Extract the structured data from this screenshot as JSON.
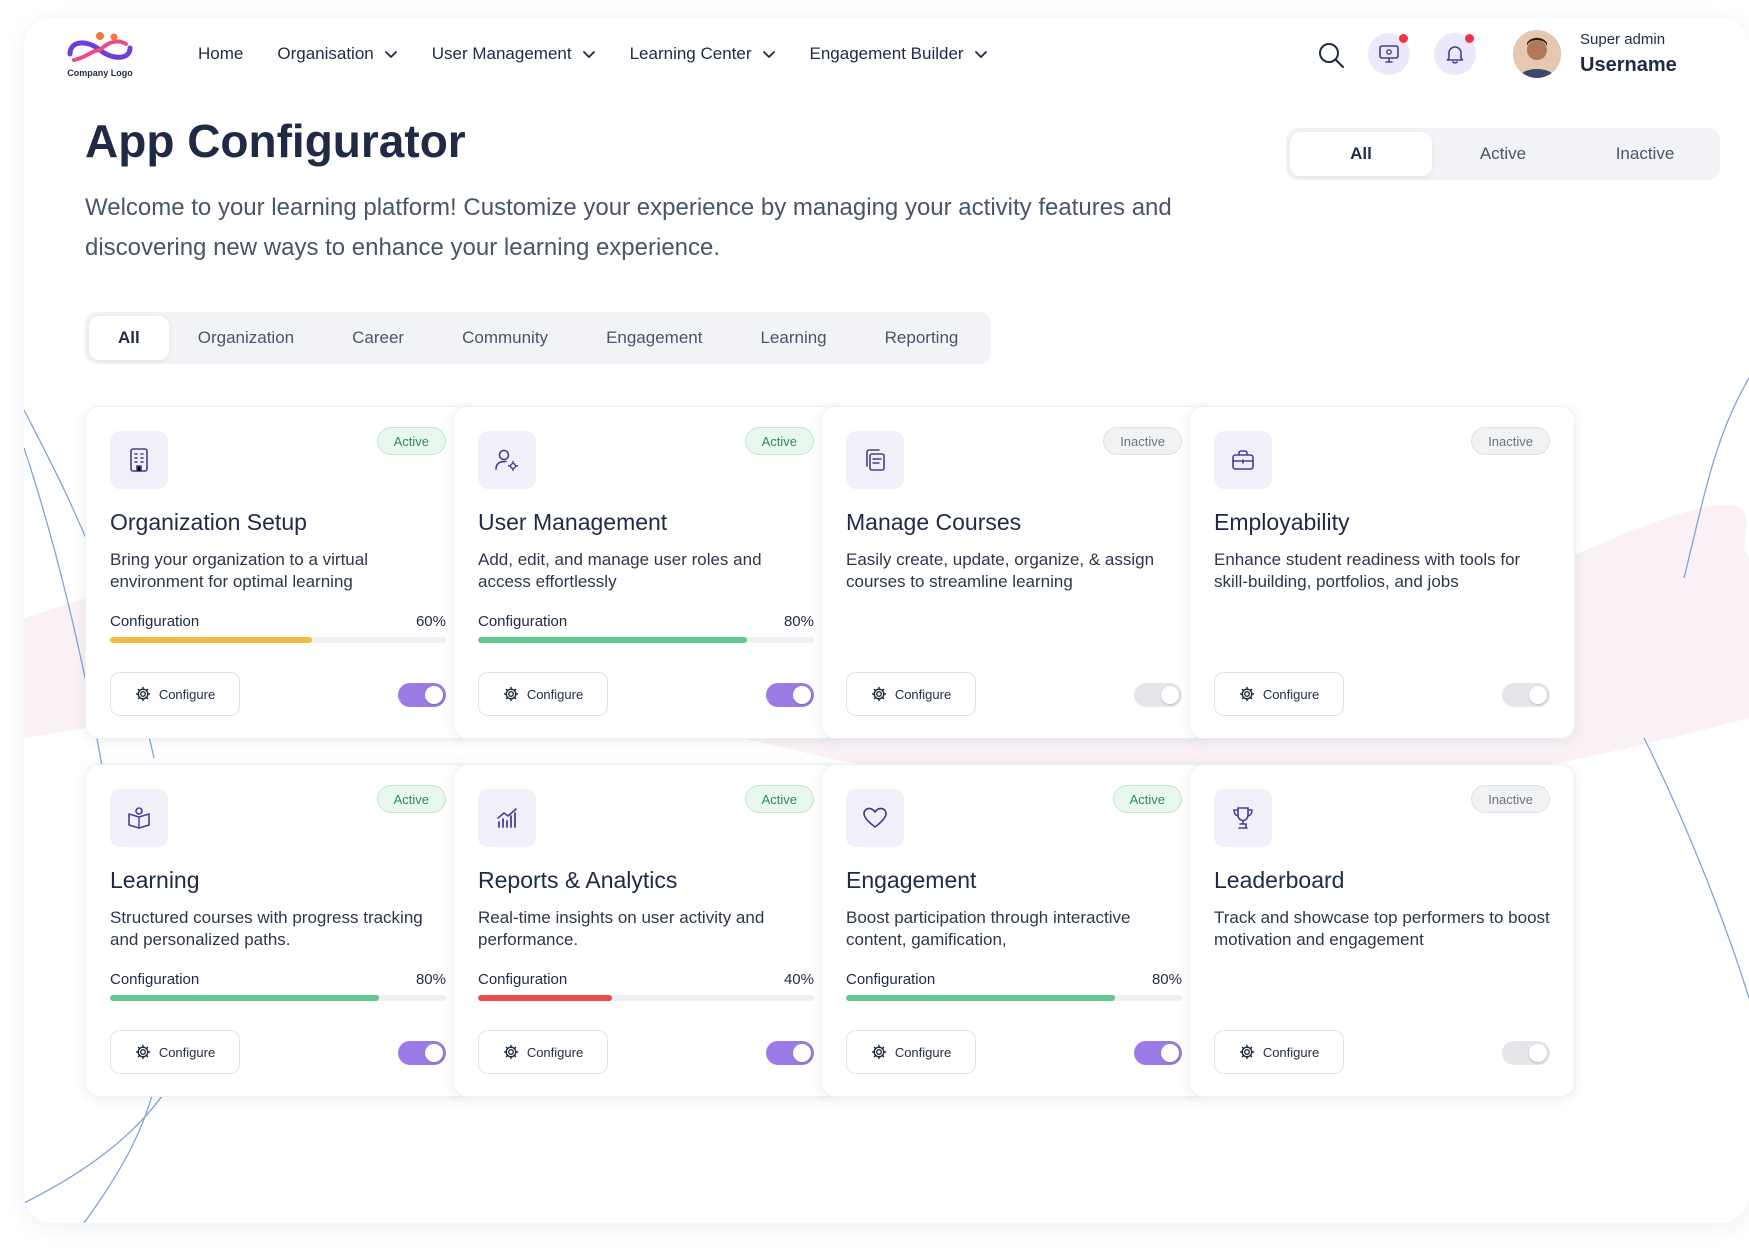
{
  "header": {
    "logo_text": "Company Logo",
    "nav": [
      {
        "label": "Home",
        "has_dropdown": false
      },
      {
        "label": "Organisation",
        "has_dropdown": true
      },
      {
        "label": "User Management",
        "has_dropdown": true
      },
      {
        "label": "Learning Center",
        "has_dropdown": true
      },
      {
        "label": "Engagement Builder",
        "has_dropdown": true
      }
    ],
    "icons": [
      "search-icon",
      "monitor-settings-icon",
      "bell-icon"
    ],
    "user_role": "Super admin",
    "user_name": "Username"
  },
  "page": {
    "title": "App Configurator",
    "description": "Welcome to your learning platform! Customize your experience by managing your activity features and discovering new ways to enhance your learning experience."
  },
  "status_filter": {
    "options": [
      "All",
      "Active",
      "Inactive"
    ],
    "selected": "All"
  },
  "category_filter": {
    "options": [
      "All",
      "Organization",
      "Career",
      "Community",
      "Engagement",
      "Learning",
      "Reporting"
    ],
    "selected": "All"
  },
  "colors": {
    "accent": "#9b7ce6",
    "progress_yellow": "#f2bd42",
    "progress_green": "#5fc990",
    "progress_red": "#ea4c4c"
  },
  "cards": [
    {
      "title": "Organization Setup",
      "description": "Bring your organization to a virtual environment for optimal learning",
      "status": "Active",
      "config_label": "Configuration",
      "progress_text": "60%",
      "progress": 0.6,
      "progress_color": "#f2bd42",
      "button_label": "Configure",
      "enabled": true,
      "icon": "building-icon"
    },
    {
      "title": "User Management",
      "description": "Add, edit, and manage user roles and access effortlessly",
      "status": "Active",
      "config_label": "Configuration",
      "progress_text": "80%",
      "progress": 0.8,
      "progress_color": "#5fc990",
      "button_label": "Configure",
      "enabled": true,
      "icon": "user-settings-icon"
    },
    {
      "title": "Manage Courses",
      "description": "Easily create, update, organize, & assign courses to streamline learning",
      "status": "Inactive",
      "button_label": "Configure",
      "enabled": false,
      "icon": "copy-courses-icon"
    },
    {
      "title": "Employability",
      "description": "Enhance student readiness with tools for skill-building, portfolios, and jobs",
      "status": "Inactive",
      "button_label": "Configure",
      "enabled": false,
      "icon": "briefcase-icon"
    },
    {
      "title": "Learning",
      "description": "Structured courses with progress tracking and personalized paths.",
      "status": "Active",
      "config_label": "Configuration",
      "progress_text": "80%",
      "progress": 0.8,
      "progress_color": "#5fc990",
      "button_label": "Configure",
      "enabled": true,
      "icon": "book-user-icon"
    },
    {
      "title": "Reports & Analytics",
      "description": "Real-time insights on user activity and performance.",
      "status": "Active",
      "config_label": "Configuration",
      "progress_text": "40%",
      "progress": 0.4,
      "progress_color": "#ea4c4c",
      "button_label": "Configure",
      "enabled": true,
      "icon": "analytics-chart-icon"
    },
    {
      "title": "Engagement",
      "description": "Boost participation through interactive content, gamification,",
      "status": "Active",
      "config_label": "Configuration",
      "progress_text": "80%",
      "progress": 0.8,
      "progress_color": "#5fc990",
      "button_label": "Configure",
      "enabled": true,
      "icon": "heart-icon"
    },
    {
      "title": "Leaderboard",
      "description": "Track and showcase top performers to boost motivation and engagement",
      "status": "Inactive",
      "button_label": "Configure",
      "enabled": false,
      "icon": "trophy-icon"
    }
  ]
}
